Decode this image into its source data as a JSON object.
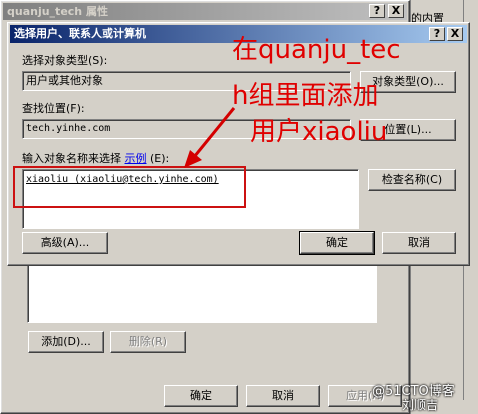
{
  "background_window": {
    "title": "quanju_tech 属性",
    "help_button": "?",
    "close_button": "X",
    "right_snippet": "的内置",
    "add_button": "添加(D)...",
    "remove_button": "删除(R)",
    "ok_button": "确定",
    "cancel_button": "取消",
    "apply_button": "应用(A)"
  },
  "dialog": {
    "title": "选择用户、联系人或计算机",
    "help_button": "?",
    "close_button": "X",
    "object_type_label": "选择对象类型(S):",
    "object_type_value": "用户或其他对象",
    "object_type_button": "对象类型(O)...",
    "location_label": "查找位置(F):",
    "location_value": "tech.yinhe.com",
    "location_button": "位置(L)...",
    "names_label": "输入对象名称来选择",
    "names_link": "示例",
    "names_label_suffix": "(E):",
    "names_value": "xiaoliu (xiaoliu@tech.yinhe.com)",
    "check_names_button": "检查名称(C)",
    "advanced_button": "高级(A)...",
    "ok_button": "确定",
    "cancel_button": "取消"
  },
  "annotation": {
    "line1": "在quanju_tec",
    "line2": "h组里面添加",
    "line3": "用户xiaoliu",
    "color": "#e00000"
  },
  "watermark": "@51CTO博客",
  "watermark_author": "刘顺吉"
}
